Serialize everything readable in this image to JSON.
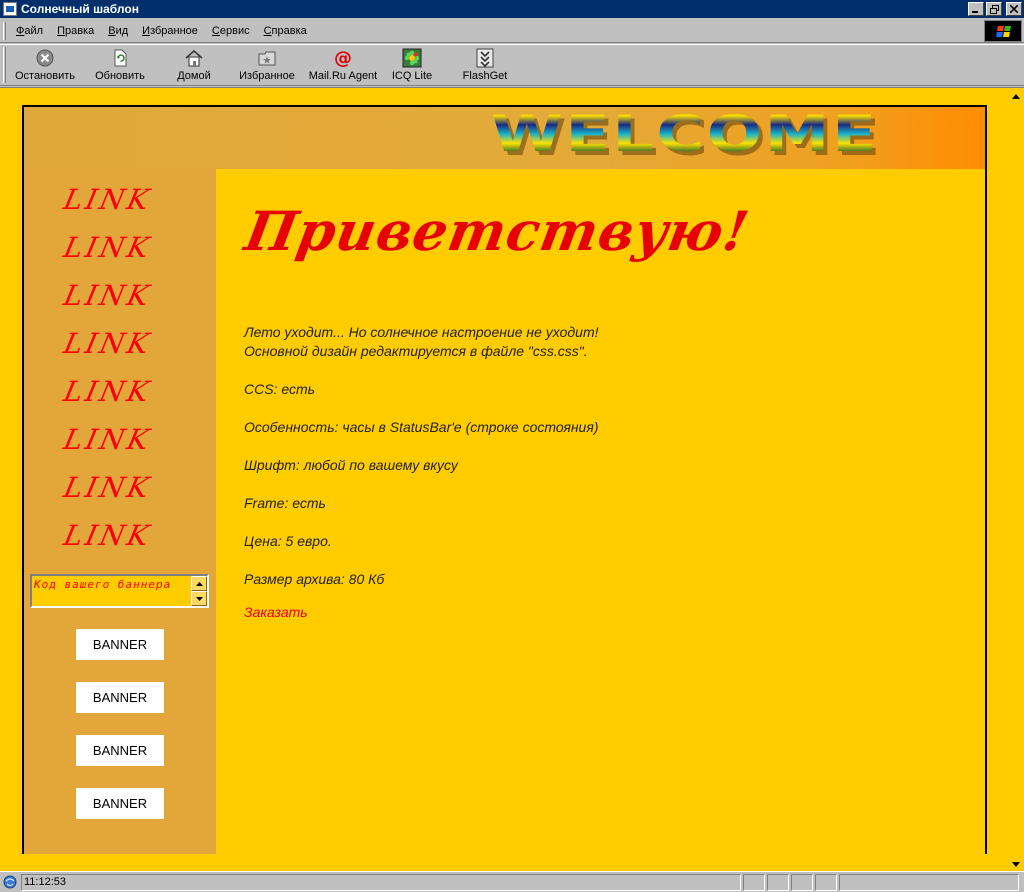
{
  "window": {
    "title": "Солнечный шаблон"
  },
  "menu": [
    {
      "key": "Ф",
      "rest": "айл"
    },
    {
      "key": "П",
      "rest": "равка"
    },
    {
      "key": "В",
      "rest": "ид"
    },
    {
      "key": "И",
      "rest": "збранное"
    },
    {
      "key": "С",
      "rest": "ервис"
    },
    {
      "key": "С",
      "rest": "правка"
    }
  ],
  "toolbar": [
    {
      "label": "Остановить",
      "icon": "stop-icon"
    },
    {
      "label": "Обновить",
      "icon": "refresh-icon"
    },
    {
      "label": "Домой",
      "icon": "home-icon"
    },
    {
      "label": "Избранное",
      "icon": "favorites-icon"
    },
    {
      "label": "Mail.Ru Agent",
      "icon": "mailru-agent-icon"
    },
    {
      "label": "ICQ Lite",
      "icon": "icq-icon"
    },
    {
      "label": "FlashGet",
      "icon": "flashget-icon"
    }
  ],
  "page": {
    "header": {
      "welcome": "WELCOME"
    },
    "sidebar": {
      "links": [
        "LINK",
        "LINK",
        "LINK",
        "LINK",
        "LINK",
        "LINK",
        "LINK",
        "LINK"
      ],
      "banner_code": "Код вашего баннера",
      "banners": [
        "BANNER",
        "BANNER",
        "BANNER",
        "BANNER"
      ]
    },
    "content": {
      "greeting": "Приветствую!",
      "intro_line1": "Лето уходит... Но солнечное настроение не уходит!",
      "intro_line2": "Основной дизайн редактируется в файле \"css.css\".",
      "css": "CCS: есть",
      "feature": "Особенность: часы в StatusBar'e (строке состояния)",
      "font": "Шрифт: любой по вашему вкусу",
      "frame": "Frame: есть",
      "price": "Цена: 5 евро.",
      "archive_size": "Размер архива: 80 Кб",
      "order": "Заказать"
    }
  },
  "status": {
    "text": "11:12:53"
  },
  "colors": {
    "page_bg": "#ffcc00",
    "sidebar_bg": "#e3a63a",
    "link": "#ff0000",
    "accent": "#ff8c00"
  }
}
